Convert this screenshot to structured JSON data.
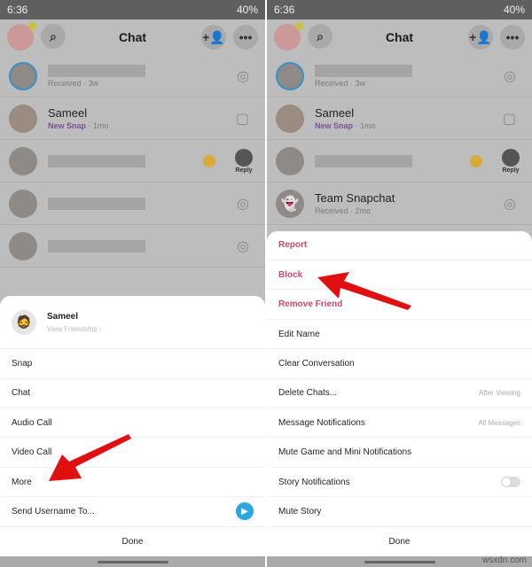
{
  "status": {
    "time": "6:36",
    "battery": "40%"
  },
  "header": {
    "title": "Chat"
  },
  "left": {
    "rows": [
      {
        "sub": "Received",
        "age": "3w"
      },
      {
        "name": "Sameel",
        "sub": "New Snap",
        "age": "1mo"
      },
      {
        "reply": "Reply"
      }
    ],
    "sheet": {
      "profile": {
        "name": "Sameel",
        "link": "View Friendship"
      },
      "items": [
        "Snap",
        "Chat",
        "Audio Call",
        "Video Call",
        "More",
        "Send Username To..."
      ],
      "done": "Done"
    }
  },
  "right": {
    "rows": [
      {
        "sub": "Received",
        "age": "3w"
      },
      {
        "name": "Sameel",
        "sub": "New Snap",
        "age": "1mo"
      },
      {
        "reply": "Reply"
      },
      {
        "name": "Team Snapchat",
        "sub": "Received",
        "age": "2mo"
      }
    ],
    "sheet": {
      "danger_items": [
        "Report",
        "Block",
        "Remove Friend"
      ],
      "items": [
        {
          "label": "Edit Name"
        },
        {
          "label": "Clear Conversation"
        },
        {
          "label": "Delete Chats...",
          "value": "After Viewing"
        },
        {
          "label": "Message Notifications",
          "value": "All Messages"
        },
        {
          "label": "Mute Game and Mini Notifications"
        },
        {
          "label": "Story Notifications",
          "toggle": false
        },
        {
          "label": "Mute Story"
        }
      ],
      "done": "Done"
    }
  },
  "colors": {
    "danger": "#c94a6d",
    "accent_arrow": "#e01010",
    "send": "#2ba8e0"
  },
  "watermark": "wsxdn.com"
}
